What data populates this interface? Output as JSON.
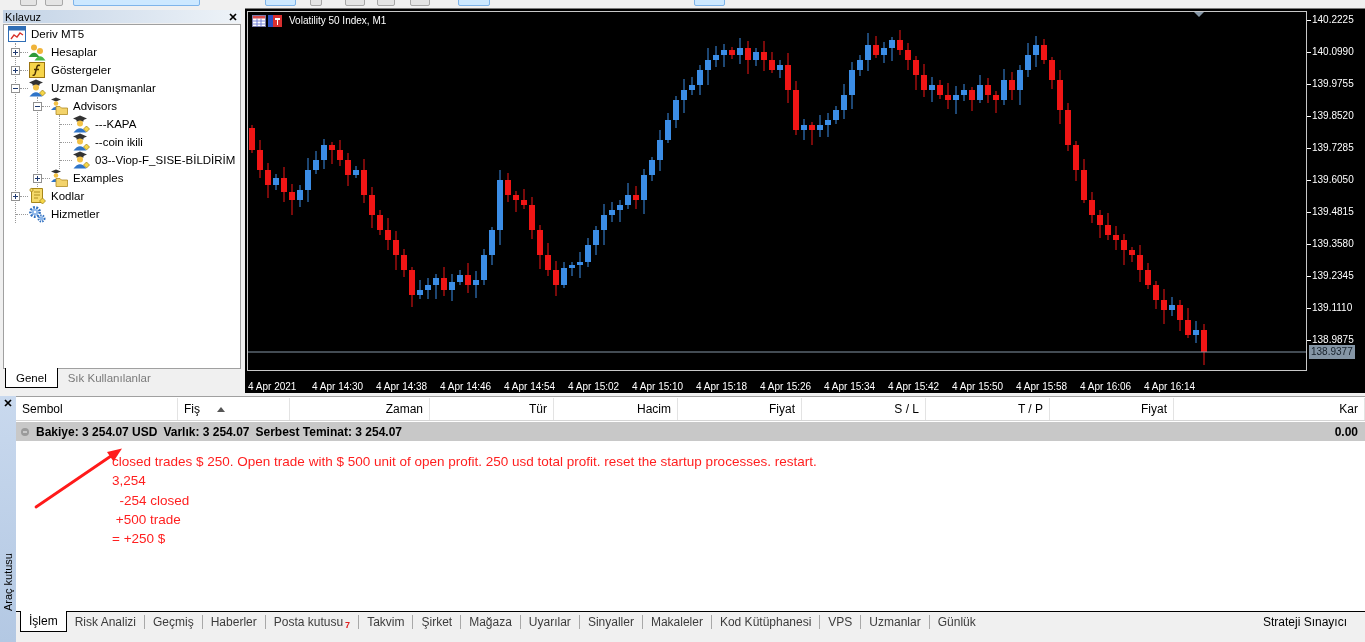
{
  "toolbar": {
    "buttons": [
      {
        "pressed": false
      },
      {
        "pressed": false
      },
      {
        "pressed": true
      },
      {
        "pressed": true
      },
      {
        "pressed": false
      },
      {
        "pressed": false
      },
      {
        "pressed": false
      },
      {
        "pressed": false
      },
      {
        "pressed": true
      },
      {
        "pressed": true
      }
    ]
  },
  "navigator": {
    "title": "Kılavuz",
    "tree": {
      "label": "Deriv MT5",
      "kind": "terminal",
      "children": [
        {
          "label": "Hesaplar",
          "kind": "accounts",
          "expanded": false
        },
        {
          "label": "Göstergeler",
          "kind": "indicators",
          "expanded": false
        },
        {
          "label": "Uzman Danışmanlar",
          "kind": "experts",
          "expanded": true,
          "children": [
            {
              "label": "Advisors",
              "kind": "expert-folder",
              "expanded": true,
              "children": [
                {
                  "label": "---KAPA",
                  "kind": "expert"
                },
                {
                  "label": "--coin ikili",
                  "kind": "expert"
                },
                {
                  "label": "03--Viop-F_SISE-BİLDİRİM",
                  "kind": "expert"
                }
              ]
            },
            {
              "label": "Examples",
              "kind": "expert-folder",
              "expanded": false
            }
          ]
        },
        {
          "label": "Kodlar",
          "kind": "scripts",
          "expanded": false
        },
        {
          "label": "Hizmetler",
          "kind": "services"
        }
      ]
    },
    "tabs": [
      {
        "label": "Genel",
        "selected": true
      },
      {
        "label": "Sık Kullanılanlar",
        "selected": false
      }
    ]
  },
  "chart": {
    "title": "Volatility 50 Index, M1",
    "price_axis": [
      "140.2225",
      "140.0990",
      "139.9755",
      "139.8520",
      "139.7285",
      "139.6050",
      "139.4815",
      "139.3580",
      "139.2345",
      "139.1110",
      "138.9875"
    ],
    "current_price": "138.9377",
    "time_axis": [
      "4 Apr 2021",
      "4 Apr 14:30",
      "4 Apr 14:38",
      "4 Apr 14:46",
      "4 Apr 14:54",
      "4 Apr 15:02",
      "4 Apr 15:10",
      "4 Apr 15:18",
      "4 Apr 15:26",
      "4 Apr 15:34",
      "4 Apr 15:42",
      "4 Apr 15:50",
      "4 Apr 15:58",
      "4 Apr 16:06",
      "4 Apr 16:14"
    ]
  },
  "toolbox": {
    "title": "Araç kutusu",
    "columns": [
      {
        "label": "Sembol",
        "sorted": false
      },
      {
        "label": "Fiş",
        "sorted": true
      },
      {
        "label": "Zaman",
        "sorted": false
      },
      {
        "label": "Tür",
        "sorted": false
      },
      {
        "label": "Hacim",
        "sorted": false
      },
      {
        "label": "Fiyat",
        "sorted": false
      },
      {
        "label": "S / L",
        "sorted": false
      },
      {
        "label": "T / P",
        "sorted": false
      },
      {
        "label": "Fiyat",
        "sorted": false
      },
      {
        "label": "Kar",
        "sorted": false
      }
    ],
    "summary": {
      "items": [
        "Bakiye: 3 254.07 USD",
        "Varlık: 3 254.07",
        "Serbest Teminat: 3 254.07"
      ],
      "profit": "0.00"
    },
    "note": [
      "closed trades $ 250. Open trade with $ 500 unit of open profit. 250 usd total profit. reset the startup processes. restart.",
      "3,254",
      "  -254 closed",
      " +500 trade",
      "= +250 $"
    ],
    "tabs": [
      {
        "label": "İşlem",
        "selected": true
      },
      {
        "label": "Risk Analizi",
        "selected": false
      },
      {
        "label": "Geçmiş",
        "selected": false
      },
      {
        "label": "Haberler",
        "selected": false
      },
      {
        "label": "Posta kutusu",
        "selected": false,
        "badge": "7"
      },
      {
        "label": "Takvim",
        "selected": false
      },
      {
        "label": "Şirket",
        "selected": false
      },
      {
        "label": "Mağaza",
        "selected": false
      },
      {
        "label": "Uyarılar",
        "selected": false
      },
      {
        "label": "Sinyaller",
        "selected": false
      },
      {
        "label": "Makaleler",
        "selected": false
      },
      {
        "label": "Kod Kütüphanesi",
        "selected": false
      },
      {
        "label": "VPS",
        "selected": false
      },
      {
        "label": "Uzmanlar",
        "selected": false
      },
      {
        "label": "Günlük",
        "selected": false
      }
    ],
    "tester_tab": {
      "label": "Strateji Sınayıcı",
      "selected": false
    }
  }
}
